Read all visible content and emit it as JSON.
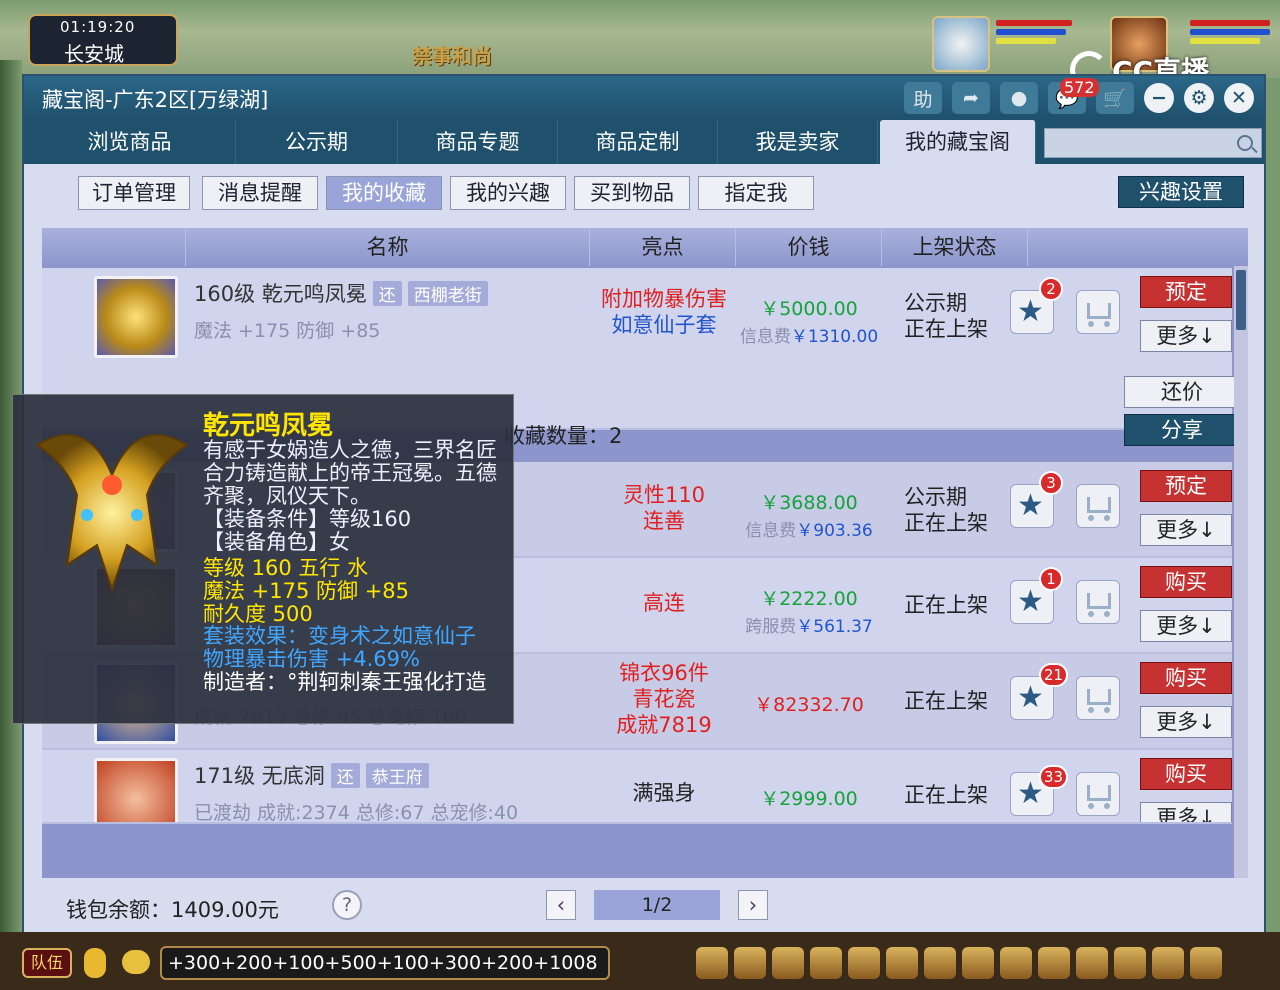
{
  "game": {
    "clock": "01:19:20",
    "city": "长安城",
    "npc_name": "禁事和尚",
    "stream_logo": "CC直播",
    "chat_input": "+300+200+100+500+100+300+200+1008",
    "team_label": "队伍"
  },
  "window": {
    "title": "藏宝阁-广东2区[万绿湖]",
    "help_button": "助",
    "message_count": "572"
  },
  "nav": {
    "tabs": [
      {
        "label": "浏览商品"
      },
      {
        "label": "公示期"
      },
      {
        "label": "商品专题"
      },
      {
        "label": "商品定制"
      },
      {
        "label": "我是卖家"
      },
      {
        "label": "我的藏宝阁"
      }
    ],
    "search_placeholder": ""
  },
  "subnav": {
    "items": [
      {
        "label": "订单管理"
      },
      {
        "label": "消息提醒"
      },
      {
        "label": "我的收藏"
      },
      {
        "label": "我的兴趣"
      },
      {
        "label": "买到物品"
      },
      {
        "label": "指定我"
      }
    ],
    "interest_settings": "兴趣设置"
  },
  "table": {
    "headers": [
      "名称",
      "亮点",
      "价钱",
      "上架状态"
    ],
    "fav_count_text": "收藏数量：2",
    "rows": [
      {
        "name": "160级 乾元鸣凤冕",
        "tags": [
          "还",
          "西棚老街"
        ],
        "sub": "魔法 +175 防御 +85",
        "highlight": [
          "附加物暴伤害",
          "如意仙子套"
        ],
        "price": "￥5000.00",
        "fee_label": "信息费",
        "fee": "￥1310.00",
        "status": [
          "公示期",
          "正在上架"
        ],
        "fav_count": "2",
        "action": "预定",
        "more": "更多↓",
        "counter": "还价",
        "share": "分享"
      },
      {
        "name": "",
        "tags": [],
        "sub": "",
        "highlight": [
          "灵性110",
          "连善"
        ],
        "price": "￥3688.00",
        "fee_label": "信息费",
        "fee": "￥903.36",
        "status": [
          "公示期",
          "正在上架"
        ],
        "fav_count": "3",
        "action": "预定",
        "more": "更多↓"
      },
      {
        "name": "",
        "tags": [],
        "sub": "",
        "highlight": [
          "高连"
        ],
        "price": "￥2222.00",
        "fee_label": "跨服费",
        "fee": "￥561.37",
        "status": [
          "正在上架"
        ],
        "fav_count": "1",
        "action": "购买",
        "more": "更多↓"
      },
      {
        "name": "",
        "tags": [],
        "sub": "成就:7819 总修:95 总宠修:100",
        "highlight": [
          "锦衣96件",
          "青花瓷",
          "成就7819"
        ],
        "price": "￥82332.70",
        "status": [
          "正在上架"
        ],
        "fav_count": "21",
        "action": "购买",
        "more": "更多↓"
      },
      {
        "name": "171级 无底洞",
        "tags": [
          "还",
          "恭王府"
        ],
        "sub": "已渡劫 成就:2374 总修:67 总宠修:40",
        "highlight": [
          "满强身"
        ],
        "price": "￥2999.00",
        "status": [
          "正在上架"
        ],
        "fav_count": "33",
        "action": "购买",
        "more": "更多↓"
      }
    ]
  },
  "footer": {
    "wallet": "钱包余额：1409.00元",
    "help": "?",
    "page": "1/2"
  },
  "tooltip": {
    "name": "乾元鸣凤冕",
    "desc": "有感于女娲造人之德，三界名匠合力铸造献上的帝王冠冕。五德齐聚，凤仪天下。",
    "req_level": "【装备条件】等级160",
    "req_role": "【装备角色】女",
    "stat_level": "等级 160  五行 水",
    "stat_magic": "魔法 +175 防御 +85",
    "stat_dur": "耐久度 500",
    "set_effect": "套装效果：变身术之如意仙子",
    "set_bonus": "物理暴击伤害 +4.69%",
    "maker": "制造者：°荆轲刺秦王强化打造"
  },
  "colors": {
    "titlebar": "#1f506c",
    "accent_red": "#c63232",
    "price_green": "#17a23b",
    "highlight_red": "#e02020",
    "highlight_blue": "#2255cc"
  }
}
